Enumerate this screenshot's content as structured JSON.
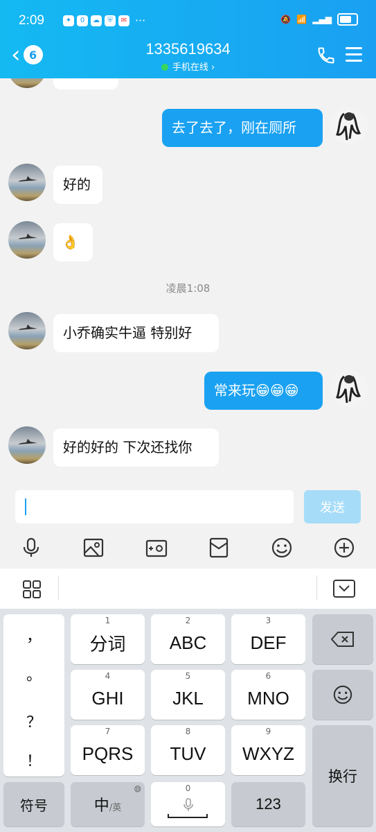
{
  "status": {
    "time": "2:09",
    "battery_pct": 75
  },
  "header": {
    "back_count": "6",
    "title": "1335619634",
    "online_text": "手机在线 ›"
  },
  "chat": {
    "timestamp": "凌晨1:08",
    "messages": [
      {
        "side": "right",
        "text": "去了去了，刚在厕所"
      },
      {
        "side": "left",
        "text": "好的"
      },
      {
        "side": "left",
        "text": "👌"
      },
      {
        "side": "left",
        "text": "小乔确实牛逼 特别好"
      },
      {
        "side": "right",
        "text": "常来玩😁😁😁"
      },
      {
        "side": "left",
        "text": "好的好的 下次还找你"
      }
    ]
  },
  "composer": {
    "input_value": "",
    "send_label": "发送"
  },
  "toolbar_icons": [
    "microphone-icon",
    "image-icon",
    "camera-icon",
    "red-packet-icon",
    "emoji-icon",
    "plus-icon"
  ],
  "keyboard": {
    "punct": [
      "，",
      "。",
      "？",
      "！"
    ],
    "keys": [
      {
        "num": "1",
        "label": "分词"
      },
      {
        "num": "2",
        "label": "ABC"
      },
      {
        "num": "3",
        "label": "DEF"
      },
      {
        "num": "4",
        "label": "GHI"
      },
      {
        "num": "5",
        "label": "JKL"
      },
      {
        "num": "6",
        "label": "MNO"
      },
      {
        "num": "7",
        "label": "PQRS"
      },
      {
        "num": "8",
        "label": "TUV"
      },
      {
        "num": "9",
        "label": "WXYZ"
      }
    ],
    "symbols_label": "符号",
    "lang_label_main": "中",
    "lang_label_sub": "/英",
    "zero_num": "0",
    "num123_label": "123",
    "enter_label": "换行"
  }
}
